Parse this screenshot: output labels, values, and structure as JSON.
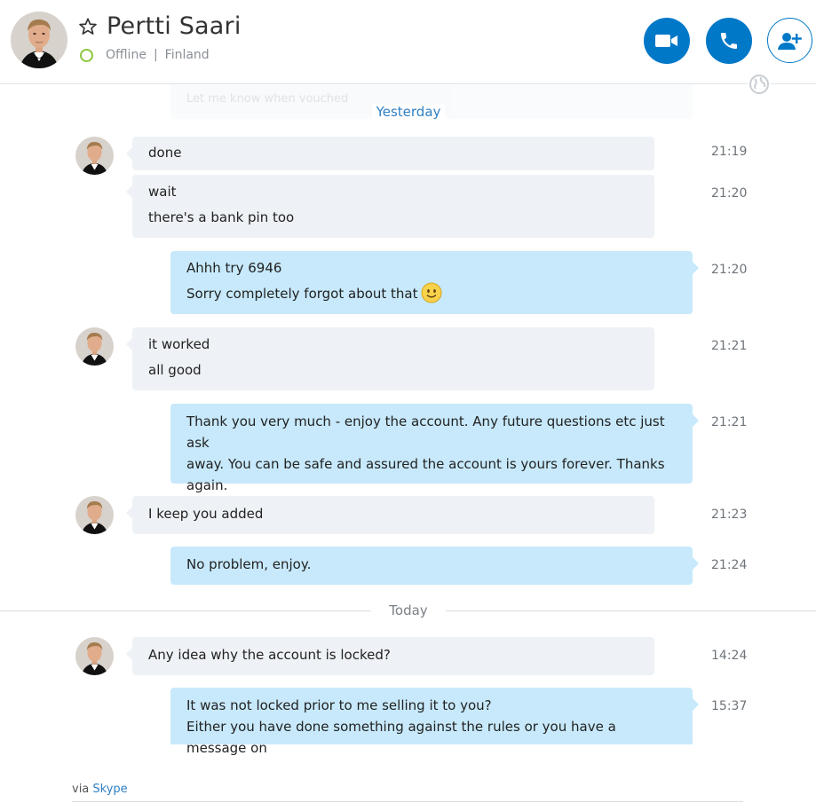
{
  "contact": {
    "name": "Pertti Saari",
    "status": "Offline",
    "location": "Finland"
  },
  "ghost_message": "Let me know when vouched",
  "days": {
    "yesterday": "Yesterday",
    "today": "Today"
  },
  "messages": [
    {
      "from": "contact",
      "lines": [
        "done"
      ],
      "time": "21:19"
    },
    {
      "from": "contact",
      "lines": [
        "wait",
        "there's a bank pin too"
      ],
      "time": "21:20"
    },
    {
      "from": "me",
      "lines": [
        "Ahhh try 6946",
        "Sorry completely forgot about that"
      ],
      "time": "21:20",
      "emoji": "smiley-emoji"
    },
    {
      "from": "contact",
      "lines": [
        "it worked",
        "all good"
      ],
      "time": "21:21"
    },
    {
      "from": "me",
      "lines": [
        "Thank you very much - enjoy the account. Any future questions etc just ask",
        "away. You can be safe and assured the account is yours forever. Thanks",
        "again."
      ],
      "time": "21:21"
    },
    {
      "from": "contact",
      "lines": [
        "I keep you added"
      ],
      "time": "21:23"
    },
    {
      "from": "me",
      "lines": [
        "No problem, enjoy."
      ],
      "time": "21:24"
    },
    {
      "from": "contact",
      "lines": [
        "Any idea why the account is locked?"
      ],
      "time": "14:24"
    },
    {
      "from": "me",
      "lines": [
        "It was not locked prior to me selling it to you?",
        "Either you have done something against the rules or you have a message on"
      ],
      "time": "15:37"
    }
  ],
  "footer": {
    "via": "via",
    "link": "Skype"
  },
  "colors": {
    "accent": "#0078c8",
    "incoming_bubble": "#eef1f5",
    "outgoing_bubble": "#c7e9fb",
    "status_offline": "#8cc63f"
  },
  "icons": {
    "favorite": "star-icon",
    "video": "video-camera-icon",
    "call": "phone-icon",
    "add": "add-person-icon",
    "globe": "globe-icon"
  }
}
